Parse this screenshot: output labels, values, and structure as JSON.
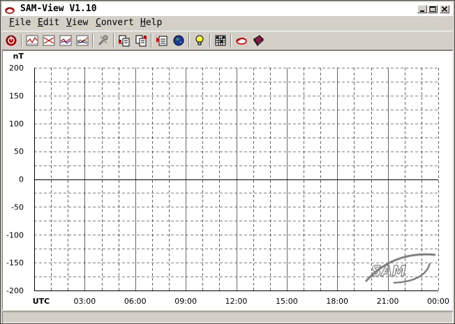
{
  "window": {
    "title": "SAM-View V1.10",
    "controls": [
      "minimize",
      "maximize",
      "close"
    ]
  },
  "menu": {
    "items": [
      {
        "mnemonic": "F",
        "rest": "ile"
      },
      {
        "mnemonic": "E",
        "rest": "dit"
      },
      {
        "mnemonic": "V",
        "rest": "iew"
      },
      {
        "mnemonic": "C",
        "rest": "onvert"
      },
      {
        "mnemonic": "H",
        "rest": "elp"
      }
    ]
  },
  "toolbar": {
    "icons": [
      "stop-icon",
      "chart-x-icon",
      "chart-y-icon",
      "chart-z-icon",
      "chart-xyz-icon",
      "tools-icon",
      "copy-icon",
      "paste-icon",
      "open-file-icon",
      "globe-icon",
      "lightbulb-icon",
      "grid-icon",
      "help-icon",
      "book-icon"
    ]
  },
  "chart_data": {
    "type": "line",
    "unit_label": "nT",
    "xlabel": "UTC",
    "x_tick_labels": [
      "03:00",
      "06:00",
      "09:00",
      "12:00",
      "15:00",
      "18:00",
      "21:00",
      "00:00"
    ],
    "y_tick_labels": [
      "200",
      "150",
      "100",
      "50",
      "0",
      "-50",
      "-100",
      "-150",
      "-200"
    ],
    "ylim": [
      -200,
      200
    ],
    "y_ticks": [
      200,
      150,
      100,
      50,
      0,
      -50,
      -100,
      -150,
      -200
    ],
    "x_range_hours": [
      0,
      24
    ],
    "x_minor_step_hours": 1,
    "x_major_step_hours": 3,
    "y_minor_step": 25,
    "grid": true,
    "series": [],
    "watermark_logo": "SAM",
    "colors": {
      "major_grid": "#000000",
      "minor_grid": "#000000",
      "zero_line": "#000000",
      "logo": "#7a7a7a"
    }
  }
}
